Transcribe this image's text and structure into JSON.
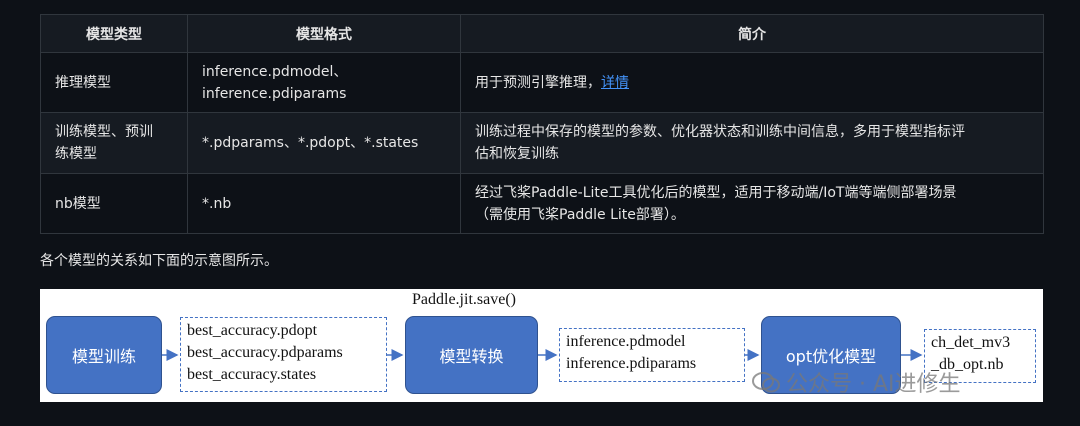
{
  "table": {
    "headers": [
      "模型类型",
      "模型格式",
      "简介"
    ],
    "rows": [
      {
        "type": "推理模型",
        "format_line1": "inference.pdmodel、",
        "format_line2": "inference.pdiparams",
        "desc_line1": "用于预测引擎推理，",
        "desc_link": "详情",
        "desc_line2": ""
      },
      {
        "type_line1": "训练模型、预训",
        "type_line2": "练模型",
        "format": "*.pdparams、*.pdopt、*.states",
        "desc_line1": "训练过程中保存的模型的参数、优化器状态和训练中间信息，多用于模型指标评",
        "desc_line2": "估和恢复训练"
      },
      {
        "type": "nb模型",
        "format": "*.nb",
        "desc_line1": "经过飞桨Paddle-Lite工具优化后的模型，适用于移动端/IoT端等端侧部署场景",
        "desc_line2": "（需使用飞桨Paddle Lite部署）。"
      }
    ]
  },
  "caption": "各个模型的关系如下面的示意图所示。",
  "diagram": {
    "box_train": "模型训练",
    "files_train": [
      "best_accuracy.pdopt",
      "best_accuracy.pdparams",
      "best_accuracy.states"
    ],
    "save_label": "Paddle.jit.save()",
    "box_convert": "模型转换",
    "files_inference": [
      "inference.pdmodel",
      "inference.pdiparams"
    ],
    "box_opt": "opt优化模型",
    "files_opt": [
      "ch_det_mv3",
      "_db_opt.nb"
    ],
    "colors": {
      "box_fill": "#4472c4",
      "dash": "#4472c4"
    }
  },
  "watermark": "公众号 · AI进修生"
}
